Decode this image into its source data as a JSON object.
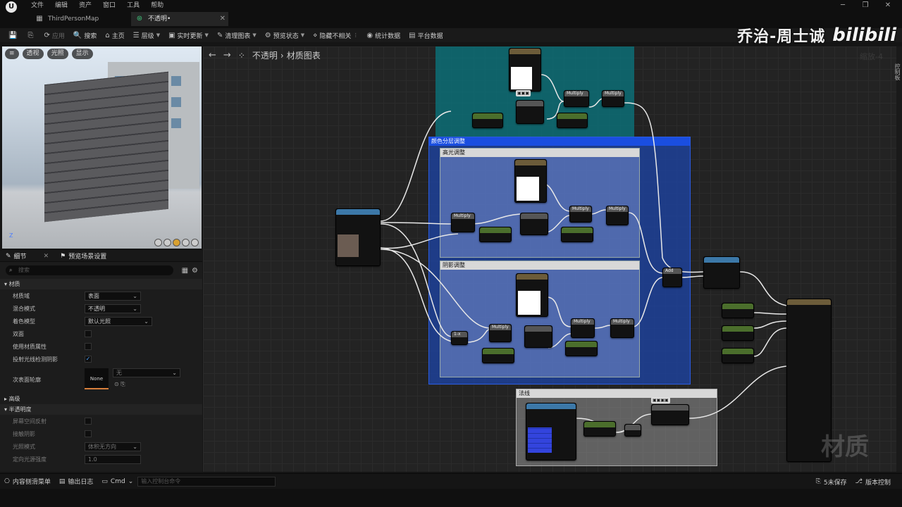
{
  "titlebar": {
    "logo": "U",
    "menus": [
      "文件",
      "编辑",
      "资产",
      "窗口",
      "工具",
      "帮助"
    ],
    "tabs": [
      {
        "label": "ThirdPersonMap",
        "icon": "map-icon"
      },
      {
        "label": "不透明•",
        "icon": "material-icon"
      }
    ],
    "window_controls": [
      "─",
      "❐",
      "✕"
    ]
  },
  "toolbar": {
    "items": [
      {
        "label": "",
        "icon": "save-icon"
      },
      {
        "label": "",
        "icon": "browse-icon"
      },
      {
        "label": "应用",
        "icon": "apply-icon",
        "disabled": true
      },
      {
        "label": "搜索",
        "icon": "search-icon"
      },
      {
        "label": "主页",
        "icon": "home-icon"
      },
      {
        "label": "层级",
        "icon": "hierarchy-icon",
        "dropdown": true
      },
      {
        "label": "实时更新",
        "icon": "live-update-icon",
        "dropdown": true
      },
      {
        "label": "清理图表",
        "icon": "clean-graph-icon",
        "dropdown": true
      },
      {
        "label": "预览状态",
        "icon": "preview-state-icon",
        "dropdown": true
      },
      {
        "label": "隐藏不相关",
        "icon": "hide-unrelated-icon"
      },
      {
        "label": "统计数据",
        "icon": "stats-icon"
      },
      {
        "label": "平台数据",
        "icon": "platform-stats-icon"
      }
    ]
  },
  "brand": {
    "name": "乔治-周士诚",
    "logo": "bilibili"
  },
  "viewport": {
    "buttons": [
      "透视",
      "光照",
      "显示"
    ],
    "axis": "Z"
  },
  "details": {
    "tabs": [
      {
        "label": "细节"
      },
      {
        "label": "预览场景设置"
      }
    ],
    "search_placeholder": "搜索",
    "sections": {
      "material": "材质",
      "advanced": "高级",
      "translucency": "半透明度"
    },
    "rows": {
      "material_domain": {
        "label": "材质域",
        "value": "表面"
      },
      "blend_mode": {
        "label": "混合模式",
        "value": "不透明"
      },
      "shading_model": {
        "label": "着色模型",
        "value": "默认光照"
      },
      "two_sided": {
        "label": "双面"
      },
      "material_attributes": {
        "label": "使用材质属性"
      },
      "ray_traced_shadows": {
        "label": "投射光线检测阴影"
      },
      "subsurface_profile": {
        "label": "次表面轮廓",
        "thumb": "None",
        "value": "无"
      },
      "ss_reflection": {
        "label": "屏幕空间反射"
      },
      "contact_shadows": {
        "label": "接触阴影"
      },
      "lighting_mode": {
        "label": "光照模式",
        "value": "体积无方向"
      },
      "directional_light_intensity": {
        "label": "定向光源强度",
        "value": "1.0"
      }
    }
  },
  "graph": {
    "breadcrumb": [
      "不透明",
      "材质图表"
    ],
    "zoom": "缩放-4",
    "side_label": "控制板",
    "watermark": "材质",
    "comments": [
      {
        "title": "颜色分层调整"
      },
      {
        "title": "高光调整"
      },
      {
        "title": "阴影调整"
      },
      {
        "title": "法线"
      }
    ]
  },
  "statusbar": {
    "content_drawer": "内容侧滑菜单",
    "output_log": "输出日志",
    "cmd": "Cmd",
    "cmd_placeholder": "输入控制台命令",
    "unsaved": "5未保存",
    "source_control": "版本控制"
  }
}
